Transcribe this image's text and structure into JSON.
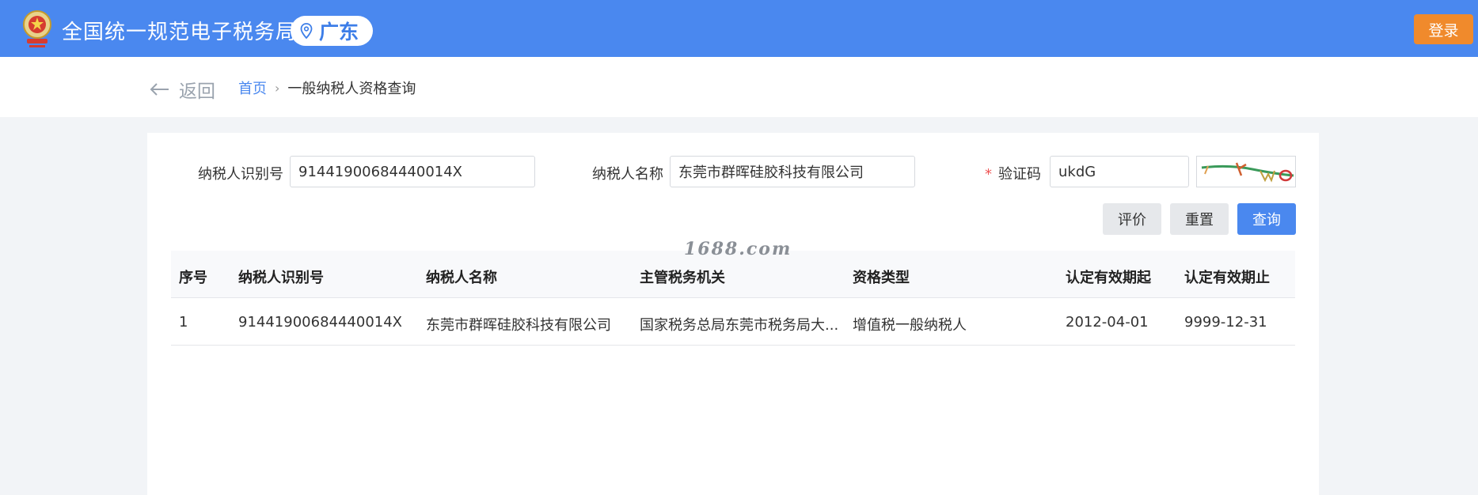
{
  "header": {
    "site_title": "全国统一规范电子税务局",
    "region": "广东",
    "login_label": "登录"
  },
  "nav": {
    "back_label": "返回",
    "breadcrumb_home": "首页",
    "breadcrumb_separator": "›",
    "breadcrumb_current": "一般纳税人资格查询"
  },
  "search": {
    "taxpayer_id_label": "纳税人识别号",
    "taxpayer_id_value": "91441900684440014X",
    "taxpayer_name_label": "纳税人名称",
    "taxpayer_name_value": "东莞市群晖硅胶科技有限公司",
    "captcha_required_mark": "*",
    "captcha_label": "验证码",
    "captcha_value": "ukdG"
  },
  "actions": {
    "evaluate_label": "评价",
    "reset_label": "重置",
    "query_label": "查询"
  },
  "watermark": "1688.com",
  "table": {
    "columns": [
      "序号",
      "纳税人识别号",
      "纳税人名称",
      "主管税务机关",
      "资格类型",
      "认定有效期起",
      "认定有效期止"
    ],
    "rows": [
      [
        "1",
        "91441900684440014X",
        "东莞市群晖硅胶科技有限公司",
        "国家税务总局东莞市税务局大...",
        "增值税一般纳税人",
        "2012-04-01",
        "9999-12-31"
      ]
    ]
  },
  "colors": {
    "header_bg": "#4a88ef",
    "login_bg": "#f08a2c",
    "primary": "#4a88ef"
  }
}
